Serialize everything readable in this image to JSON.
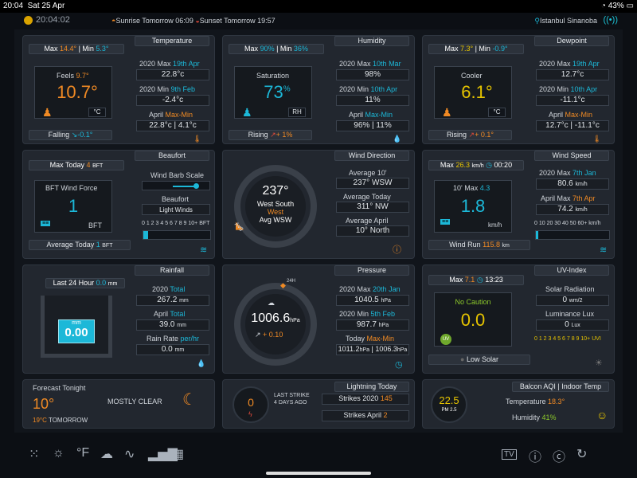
{
  "status": {
    "time": "20:04",
    "date": "Sat 25 Apr",
    "battery": "43%"
  },
  "top": {
    "time": "20:04:02",
    "sunrise": "Sunrise Tomorrow 06:09",
    "sunset": "Sunset Tomorrow 19:57",
    "location": "Istanbul Sinanoba"
  },
  "temperature": {
    "title": "Temperature",
    "maxmin_prefix": "Max ",
    "max": "14.4°",
    "min_label": " | Min ",
    "min": "5.3°",
    "feels_label": "Feels",
    "feels": "9.7°",
    "value": "10.7°",
    "unit": "°C",
    "trend": "Falling",
    "trend_val": "-0.1°",
    "r1_label": "2020 Max",
    "r1_date": "19th Apr",
    "r1_val": "22.8°c",
    "r2_label": "2020 Min",
    "r2_date": "9th Feb",
    "r2_val": "-2.4°c",
    "r3_label": "April",
    "r3_range": "Max-Min",
    "r3_val": "22.8°c | 4.1°c"
  },
  "humidity": {
    "title": "Humidity",
    "max": "90%",
    "min": "36%",
    "inner_label": "Saturation",
    "value": "73",
    "unit_pct": "%",
    "unit": "RH",
    "trend": "Rising",
    "trend_val": "+ 1%",
    "r1_label": "2020 Max",
    "r1_date": "10th Mar",
    "r1_val": "98%",
    "r2_label": "2020 Min",
    "r2_date": "10th Apr",
    "r2_val": "11%",
    "r3_label": "April",
    "r3_range": "Max-Min",
    "r3_val": "96% | 11%"
  },
  "dewpoint": {
    "title": "Dewpoint",
    "max": "7.3°",
    "min": "-0.9°",
    "inner_label": "Cooler",
    "value": "6.1°",
    "unit": "°C",
    "trend": "Rising",
    "trend_val": "+ 0.1°",
    "r1_label": "2020 Max",
    "r1_date": "19th Apr",
    "r1_val": "12.7°c",
    "r2_label": "2020 Min",
    "r2_date": "10th Apr",
    "r2_val": "-11.1°c",
    "r3_label": "April",
    "r3_range": "Max-Min",
    "r3_val": "12.7°c | -11.1°c"
  },
  "beaufort": {
    "title": "Beaufort",
    "max_label": "Max Today",
    "max": "4",
    "bft": "BFT",
    "inner_label": "BFT Wind Force",
    "value": "1",
    "avg_label": "Average Today",
    "avg": "1",
    "scale_label": "Wind Barb Scale",
    "beaufort_label": "Beaufort",
    "light": "Light Winds",
    "scale": "0 1 2 3 4 5 6 7 8 9 10+ BFT"
  },
  "winddir": {
    "title": "Wind Direction",
    "deg": "237°",
    "dir": "West South",
    "dir2": "West",
    "avg": "Avg WSW",
    "avg_tag": "Avg",
    "r1_label": "Average 10'",
    "r1_val": "237°  WSW",
    "r2_label": "Average Today",
    "r2_val": "311°  NW",
    "r3_label": "Average April",
    "r3_val": "10°  North"
  },
  "windspeed": {
    "title": "Wind Speed",
    "max_label": "Max",
    "max": "26.3",
    "kmh": "km/h",
    "max_time": "00:20",
    "inner_label": "10' Max",
    "inner_max": "4.3",
    "value": "1.8",
    "unit": "km/h",
    "run_label": "Wind Run",
    "run": "115.8",
    "run_unit": "km",
    "r1_label": "2020 Max",
    "r1_date": "7th Jan",
    "r1_val": "80.6",
    "r2_label": "April Max",
    "r2_date": "7th Apr",
    "r2_val": "74.2",
    "scale": "0 10 20 30 40 50 60+ km/h"
  },
  "rainfall": {
    "title": "Rainfall",
    "last24_label": "Last 24 Hour",
    "last24": "0.0",
    "mm": "mm",
    "value": "0.00",
    "r1_label": "2020",
    "r1_tag": "Total",
    "r1_val": "267.2",
    "r2_label": "April",
    "r2_tag": "Total",
    "r2_val": "39.0",
    "r3_label": "Rain Rate",
    "r3_tag": "per/hr",
    "r3_val": "0.0"
  },
  "pressure": {
    "title": "Pressure",
    "value": "1006.6",
    "unit": "hPa",
    "trend": "+ 0.10",
    "tag": "24H",
    "r1_label": "2020 Max",
    "r1_date": "20th Jan",
    "r1_val": "1040.5",
    "r2_label": "2020 Min",
    "r2_date": "5th Feb",
    "r2_val": "987.7",
    "r3_label": "Today",
    "r3_range": "Max-Min",
    "r3_val_a": "1011.2",
    "r3_val_b": "1006.3"
  },
  "uv": {
    "title": "UV-Index",
    "max_label": "Max",
    "max": "7.1",
    "time": "13:23",
    "caution": "No Caution",
    "value": "0.0",
    "badge": "UV",
    "solar_label": "Low Solar",
    "sr_label": "Solar Radiation",
    "sr_val": "0",
    "sr_unit": "wm/2",
    "lum_label": "Luminance Lux",
    "lum_val": "0",
    "lum_unit": "Lux",
    "scale": "0 1 2 3 4 5 6 7 8 9 10+ UVI"
  },
  "forecast": {
    "title": "Forecast Tonight",
    "temp": "10°",
    "desc": "MOSTLY CLEAR",
    "tomorrow_temp": "19°C",
    "tomorrow": "TOMORROW"
  },
  "lightning": {
    "title": "Lightning Today",
    "count": "0",
    "last_label": "LAST STRIKE",
    "last_ago": "4 DAYS AGO",
    "s2020_label": "Strikes 2020",
    "s2020": "145",
    "sapr_label": "Strikes April",
    "sapr": "2"
  },
  "indoor": {
    "title": "Balcon AQI | Indoor Temp",
    "aqi": "22.5",
    "pm": "PM 2.5",
    "temp_label": "Temperature",
    "temp": "18.3°",
    "hum_label": "Humidity",
    "hum": "41%"
  },
  "bottom": {
    "unit": "°F",
    "tv": "TV"
  }
}
